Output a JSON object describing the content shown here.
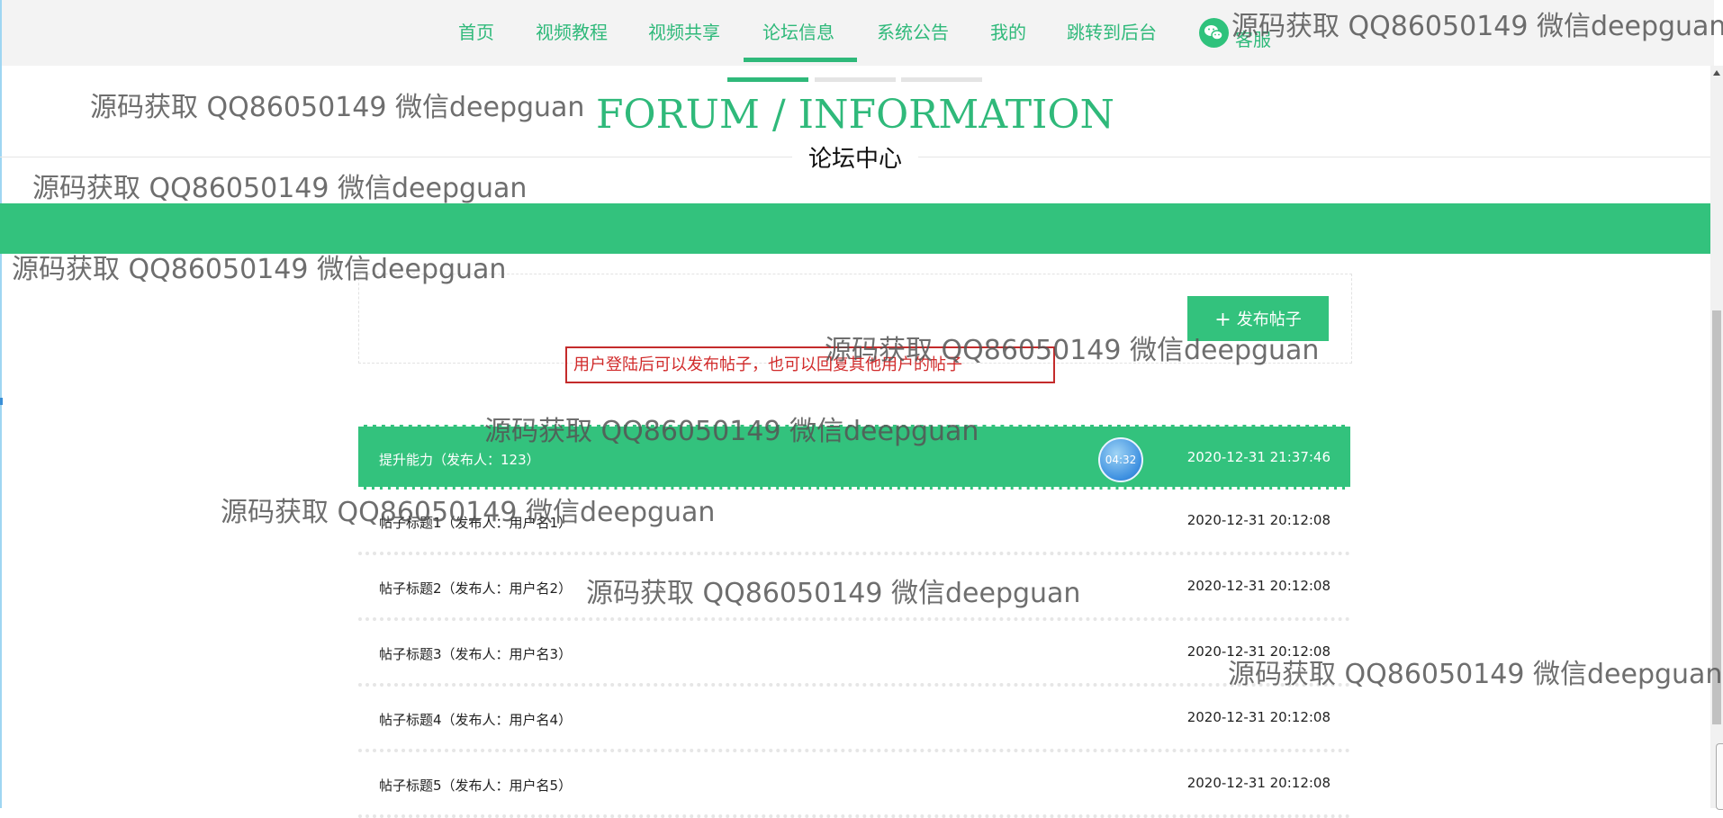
{
  "nav": {
    "items": [
      "首页",
      "视频教程",
      "视频共享",
      "论坛信息",
      "系统公告",
      "我的",
      "跳转到后台"
    ],
    "active": "论坛信息",
    "service_label": "客服"
  },
  "section": {
    "title_en": "FORUM / INFORMATION",
    "title_cn": "论坛中心"
  },
  "forum": {
    "publish_label": "发布帖子",
    "notice": "用户登陆后可以发布帖子，也可以回复其他用户的帖子",
    "clock": "04:32",
    "posts": [
      {
        "title": "提升能力（发布人：123）",
        "time": "2020-12-31 21:37:46"
      },
      {
        "title": "帖子标题1（发布人：用户名1）",
        "time": "2020-12-31 20:12:08"
      },
      {
        "title": "帖子标题2（发布人：用户名2）",
        "time": "2020-12-31 20:12:08"
      },
      {
        "title": "帖子标题3（发布人：用户名3）",
        "time": "2020-12-31 20:12:08"
      },
      {
        "title": "帖子标题4（发布人：用户名4）",
        "time": "2020-12-31 20:12:08"
      },
      {
        "title": "帖子标题5（发布人：用户名5）",
        "time": "2020-12-31 20:12:08"
      }
    ]
  },
  "watermark": "源码获取 QQ86050149 微信deepguan",
  "colors": {
    "accent": "#33c27d",
    "notice": "#d12b2b"
  }
}
